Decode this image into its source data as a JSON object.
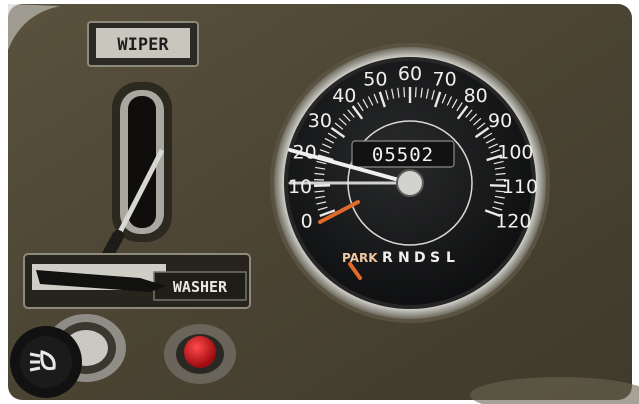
{
  "colors": {
    "dash": "#4d4634",
    "dial_face": "#161718",
    "needle": "#f0f0ee",
    "orange": "#e06a2a",
    "button_red": "#d4141a"
  },
  "wiper_label": "WIPER",
  "washer_label": "WASHER",
  "speedometer": {
    "odometer": "05502",
    "speed_marks": [
      "0",
      "10",
      "20",
      "30",
      "40",
      "50",
      "60",
      "70",
      "80",
      "90",
      "100",
      "110",
      "120"
    ],
    "park_label": "PARK",
    "gear_letters": [
      "R",
      "N",
      "D",
      "S",
      "L"
    ]
  },
  "icons": {
    "headlight_knob": "headlight-icon",
    "red_button": "push-button-icon"
  }
}
